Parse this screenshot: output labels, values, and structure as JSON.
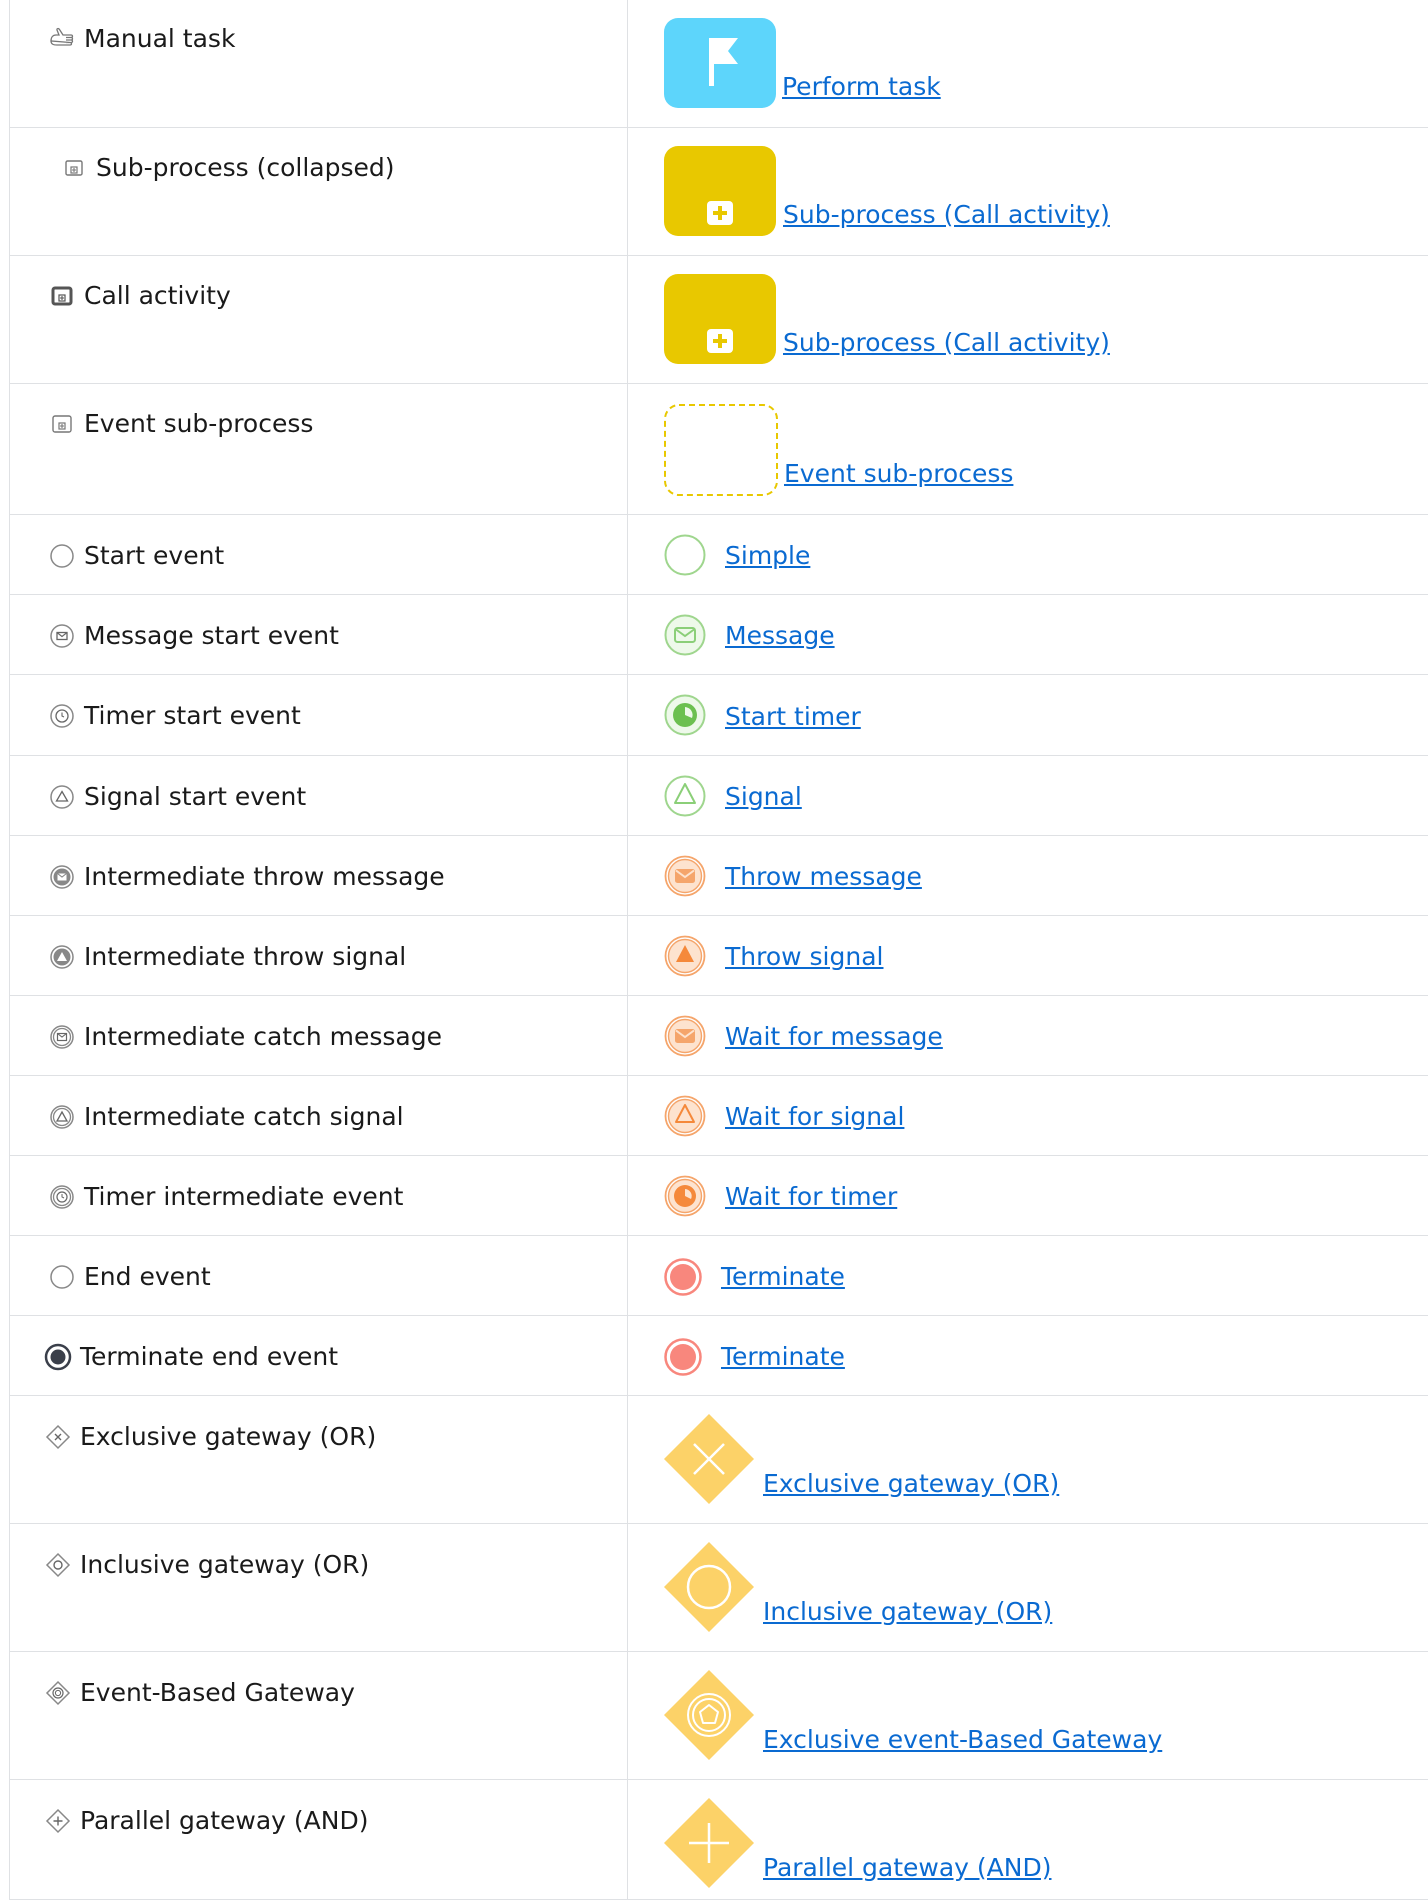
{
  "rows": [
    {
      "label": "Manual task",
      "link": "Perform task"
    },
    {
      "label": "Sub-process (collapsed)",
      "link": "Sub-process (Call activity)"
    },
    {
      "label": "Call activity",
      "link": "Sub-process (Call activity)"
    },
    {
      "label": "Event sub-process",
      "link": "Event sub-process"
    },
    {
      "label": "Start event",
      "link": "Simple"
    },
    {
      "label": "Message start event",
      "link": "Message"
    },
    {
      "label": "Timer start event",
      "link": "Start timer"
    },
    {
      "label": "Signal start event",
      "link": "Signal"
    },
    {
      "label": "Intermediate throw message",
      "link": "Throw message"
    },
    {
      "label": "Intermediate throw signal",
      "link": "Throw signal"
    },
    {
      "label": "Intermediate catch message",
      "link": "Wait for message"
    },
    {
      "label": "Intermediate catch signal",
      "link": "Wait for signal"
    },
    {
      "label": "Timer intermediate event",
      "link": "Wait for timer"
    },
    {
      "label": "End event",
      "link": "Terminate"
    },
    {
      "label": "Terminate end event",
      "link": "Terminate"
    },
    {
      "label": "Exclusive gateway (OR)",
      "link": "Exclusive gateway (OR)"
    },
    {
      "label": "Inclusive gateway (OR)",
      "link": "Inclusive gateway (OR)"
    },
    {
      "label": "Event-Based Gateway",
      "link": "Exclusive event-Based Gateway"
    },
    {
      "label": "Parallel gateway (AND)",
      "link": "Parallel gateway (AND)"
    }
  ],
  "colors": {
    "task_blue": "#5dd5fb",
    "subprocess_yellow": "#e8c800",
    "start_green": "#9fd68e",
    "intermediate_orange": "#f5a56b",
    "end_red": "#f8877d",
    "gateway_yellow": "#fcd268",
    "link": "#0a6ad1",
    "border": "#dfe1e4"
  }
}
